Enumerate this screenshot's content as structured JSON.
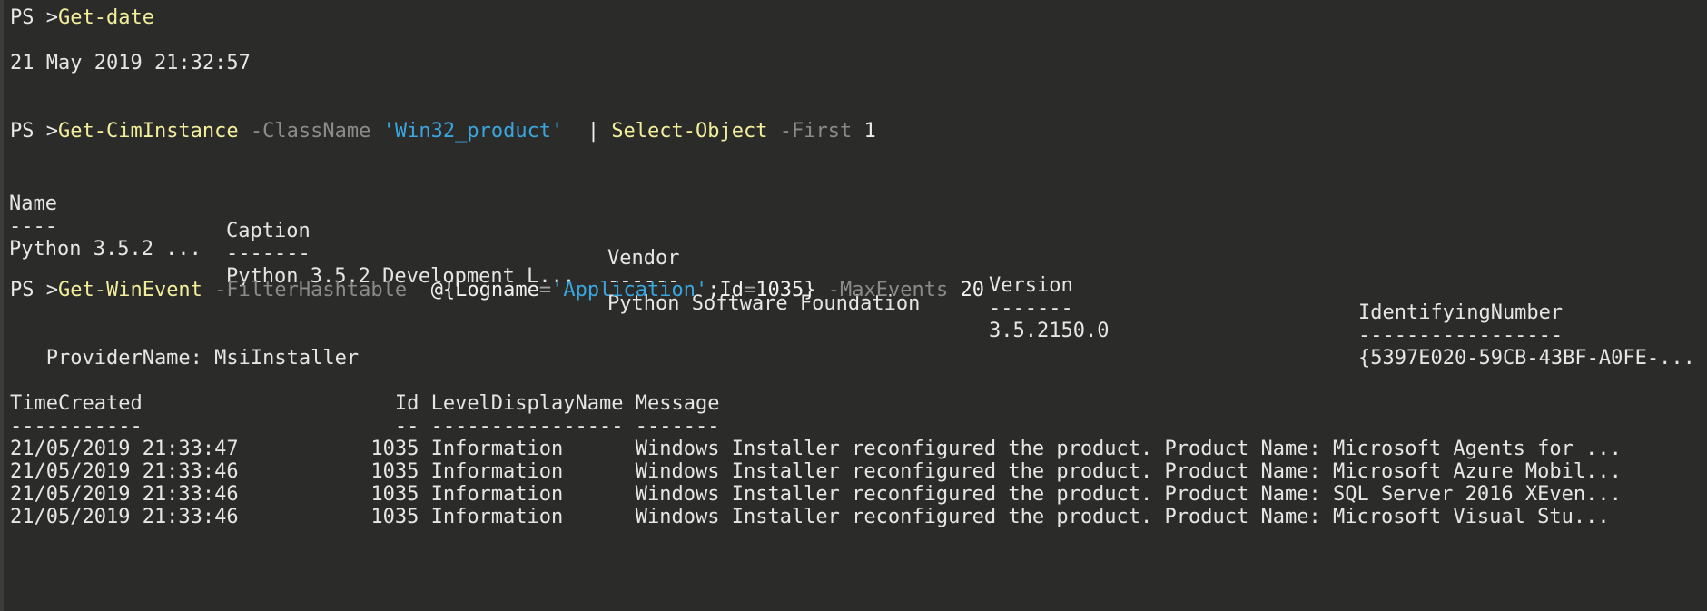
{
  "prompt": "PS >",
  "cmd1": {
    "name": "Get-date"
  },
  "date_output": "21 May 2019 21:32:57",
  "cmd2": {
    "name": "Get-CimInstance",
    "param1": "-ClassName",
    "arg1": "'Win32_product'",
    "pipe": "|",
    "name2": "Select-Object",
    "param2": "-First",
    "arg2": "1"
  },
  "product_table": {
    "headers": [
      "Name",
      "Caption",
      "Vendor",
      "Version",
      "IdentifyingNumber"
    ],
    "underlines": [
      "----",
      "-------",
      "------",
      "-------",
      "-----------------"
    ],
    "rows": [
      [
        "Python 3.5.2 ...",
        "Python 3.5.2 Development L...",
        "Python Software Foundation",
        "3.5.2150.0",
        "{5397E020-59CB-43BF-A0FE-..."
      ]
    ]
  },
  "cmd3": {
    "name": "Get-WinEvent",
    "param1": "-FilterHashtable",
    "hash_open": "@{",
    "key1": "Logname",
    "eq": "=",
    "val1": "'Application'",
    "sep": ";",
    "key2": "Id",
    "val2": "1035",
    "hash_close": "}",
    "param2": "-MaxEvents",
    "arg2": "20"
  },
  "provider_line": "   ProviderName: MsiInstaller",
  "event_table": {
    "header": "TimeCreated                     Id LevelDisplayName Message",
    "underline": "-----------                     -- ---------------- -------",
    "rows": [
      "21/05/2019 21:33:47           1035 Information      Windows Installer reconfigured the product. Product Name: Microsoft Agents for ...",
      "21/05/2019 21:33:46           1035 Information      Windows Installer reconfigured the product. Product Name: Microsoft Azure Mobil...",
      "21/05/2019 21:33:46           1035 Information      Windows Installer reconfigured the product. Product Name: SQL Server 2016 XEven...",
      "21/05/2019 21:33:46           1035 Information      Windows Installer reconfigured the product. Product Name: Microsoft Visual Stu..."
    ]
  }
}
